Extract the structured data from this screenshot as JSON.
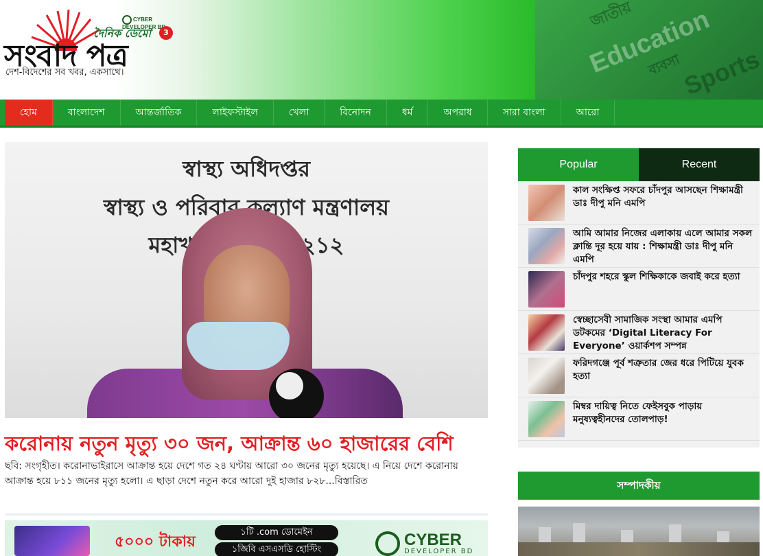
{
  "header": {
    "logo_main": "সংবাদ পত্র",
    "logo_daily": "দৈনিক ডেমো",
    "logo_badge": "3",
    "cyber_mini": "CYBER DEVELOPER BD",
    "tagline": "দেশ-বিদেশের সব খবর, একসাথে।",
    "deco_education": "Education",
    "deco_sports": "Sports"
  },
  "nav": {
    "items": [
      {
        "label": "হোম",
        "active": true
      },
      {
        "label": "বাংলাদেশ"
      },
      {
        "label": "আন্তর্জাতিক"
      },
      {
        "label": "লাইফস্টাইল"
      },
      {
        "label": "খেলা"
      },
      {
        "label": "বিনোদন"
      },
      {
        "label": "ধর্ম"
      },
      {
        "label": "অপরাধ"
      },
      {
        "label": "সারা বাংলা"
      },
      {
        "label": "আরো"
      }
    ]
  },
  "lead": {
    "sign_line1": "স্বাস্থ্য অধিদপ্তর",
    "sign_line2": "স্বাস্থ্য ও পরিবার কল্যাণ মন্ত্রণালয়",
    "sign_line3": "মহাখালী, ঢাকা-১২১২",
    "title": "করোনায় নতুন মৃত্যু ৩০ জন, আক্রান্ত ৬০ হাজারের বেশি",
    "summary": "ছবি: সংগৃহীত। করোনাভাইরাসে আক্রান্ত হয়ে দেশে গত ২৪ ঘণ্টায় আরো ৩০ জনের মৃত্যু হয়েছে। এ নিয়ে দেশে করোনায় আক্রান্ত হয়ে ৮১১ জনের মৃত্যু হলো। এ ছাড়া দেশে নতুন করে আরো দুই হাজার ৮২৮...",
    "read_more": "বিস্তারিত"
  },
  "ad": {
    "price": "৫০০০ টাকায়",
    "pill1": "১টি .com ডোমেইন",
    "pill2": "১জিবি এসএসডি হোস্টিং",
    "brand": "CYBER",
    "brand_sub": "DEVELOPER BD"
  },
  "sidebar": {
    "tab_popular": "Popular",
    "tab_recent": "Recent",
    "items": [
      {
        "title": "কাল সংক্ষিপ্ত সফরে চাঁদপুর আসছেন শিক্ষামন্ত্রী ডাঃ দীপু মনি এমপি"
      },
      {
        "title": "আমি আমার নিজের এলাকায় এলে আমার সকল ক্লান্তি দূর হয়ে যায় : শিক্ষামন্ত্রী ডাঃ দীপু মনি এমপি"
      },
      {
        "title": "চাঁদপুর শহরে স্কুল শিক্ষিকাকে জবাই করে হত্যা"
      },
      {
        "title": "স্বেচ্ছাসেবী সামাজিক সংস্থা আমার এমপি ডটকমের ‘Digital Literacy For Everyone’ ওয়ার্কশপ সম্পন্ন"
      },
      {
        "title": "ফরিদগঞ্জে পূর্ব শত্রুতার জের ধরে পিটিয়ে যুবক হত্যা"
      },
      {
        "title": "মিম্বর দায়িত্ব নিতে ফেইসবুক পাড়ায় মনুষ্যত্বহীনদের তোলপাড়!"
      }
    ],
    "editorial_title": "সম্পাদকীয়"
  },
  "colors": {
    "brand_green": "#1f9a30",
    "nav_active": "#e32c1d",
    "headline_red": "#e31e24",
    "tab_dark": "#0e2a12"
  }
}
